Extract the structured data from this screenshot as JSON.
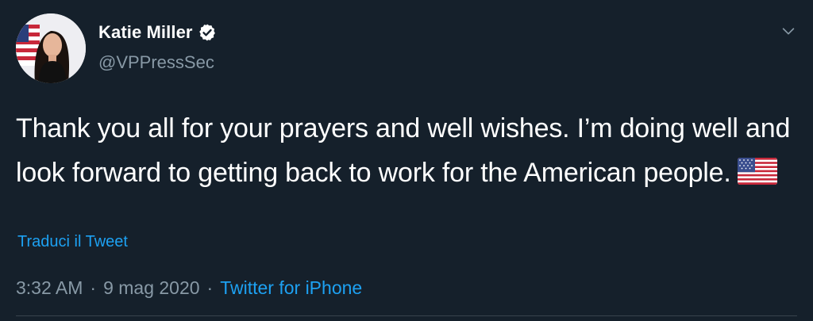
{
  "author": {
    "display_name": "Katie Miller",
    "handle": "@VPPressSec",
    "verified": true,
    "avatar_icon": "profile-photo-avatar",
    "verified_icon": "verified-badge-icon"
  },
  "menu": {
    "icon": "chevron-down-icon"
  },
  "tweet": {
    "text": "Thank you all for your prayers and well wishes. I’m doing well and look forward to getting back to work for the American people.",
    "emoji_icon": "us-flag-emoji"
  },
  "translate": {
    "label": "Traduci il Tweet"
  },
  "meta": {
    "time": "3:32 AM",
    "separator": "·",
    "date": "9 mag 2020",
    "source": "Twitter for iPhone"
  },
  "colors": {
    "background": "#15202b",
    "text_primary": "#ffffff",
    "text_secondary": "#8899a6",
    "accent": "#1da1f2",
    "divider": "#38444d"
  }
}
